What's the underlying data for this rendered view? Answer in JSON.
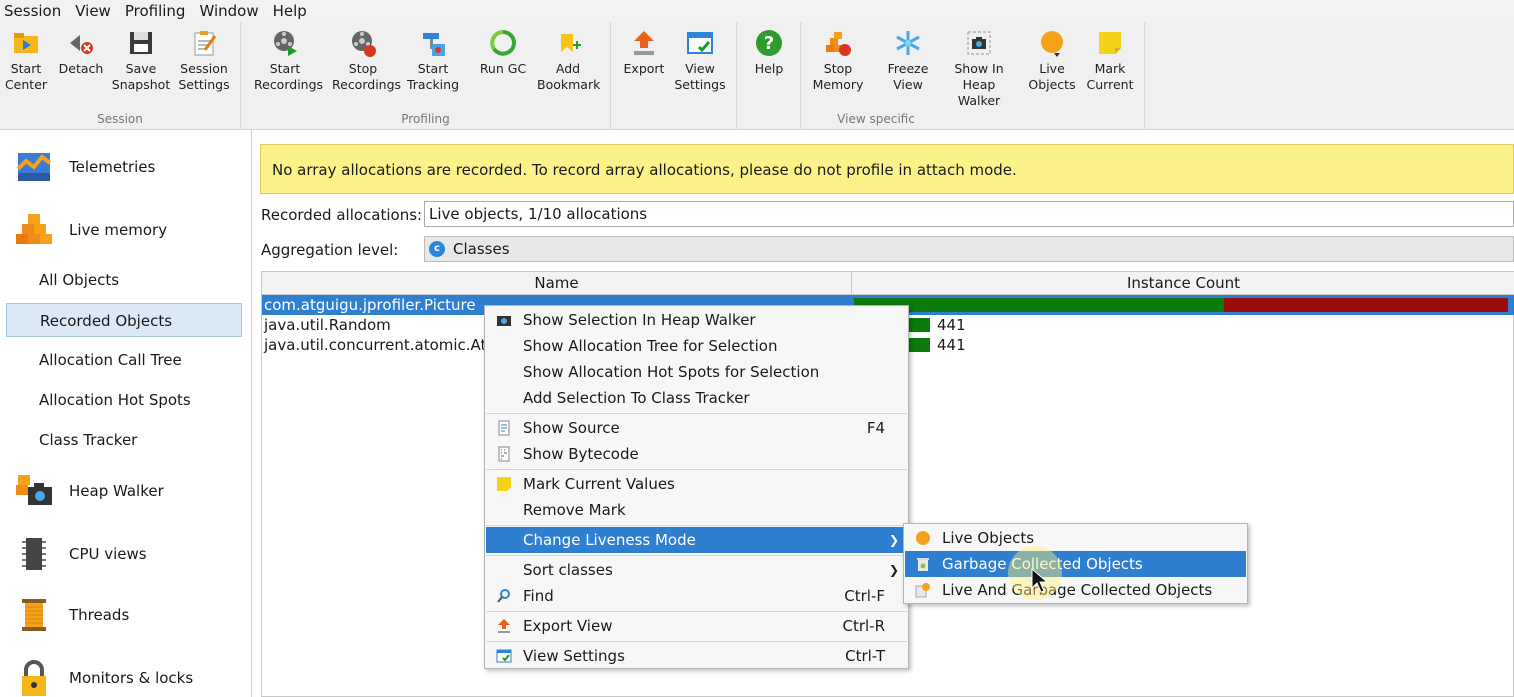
{
  "menubar": [
    "Session",
    "View",
    "Profiling",
    "Window",
    "Help"
  ],
  "toolbar": {
    "groups": {
      "session": "Session",
      "profiling": "Profiling",
      "view_specific": "View specific"
    },
    "buttons": {
      "start_center": "Start\nCenter",
      "detach": "Detach",
      "save_snapshot": "Save\nSnapshot",
      "session_settings": "Session\nSettings",
      "start_recordings": "Start\nRecordings",
      "stop_recordings": "Stop\nRecordings",
      "start_tracking": "Start\nTracking",
      "run_gc": "Run GC",
      "add_bookmark": "Add\nBookmark",
      "export": "Export",
      "view_settings": "View\nSettings",
      "help": "Help",
      "stop_memory": "Stop\nMemory",
      "freeze_view": "Freeze\nView",
      "show_in_heap_walker": "Show In\nHeap Walker",
      "live_objects": "Live\nObjects",
      "mark_current": "Mark\nCurrent"
    }
  },
  "sidebar": {
    "telemetries": "Telemetries",
    "live_memory": "Live memory",
    "sub": [
      "All Objects",
      "Recorded Objects",
      "Allocation Call Tree",
      "Allocation Hot Spots",
      "Class Tracker"
    ],
    "heap_walker": "Heap Walker",
    "cpu_views": "CPU views",
    "threads": "Threads",
    "monitors_locks": "Monitors & locks"
  },
  "banner": "No array allocations are recorded. To record array allocations, please do not profile in attach mode.",
  "recorded": {
    "label": "Recorded allocations:",
    "value": "Live objects, 1/10 allocations"
  },
  "aggregation": {
    "label": "Aggregation level:",
    "value": "Classes"
  },
  "table": {
    "headers": [
      "Name",
      "Instance Count"
    ],
    "rows": [
      {
        "name": "com.atguigu.jprofiler.Picture",
        "count": ""
      },
      {
        "name": "java.util.Random",
        "count": "441"
      },
      {
        "name": "java.util.concurrent.atomic.Ato",
        "count": "441"
      }
    ]
  },
  "context_menu": {
    "show_selection_heap_walker": "Show Selection In Heap Walker",
    "show_alloc_tree": "Show Allocation Tree for Selection",
    "show_alloc_hot": "Show Allocation Hot Spots for Selection",
    "add_class_tracker": "Add Selection To Class Tracker",
    "show_source": "Show Source",
    "show_source_sc": "F4",
    "show_bytecode": "Show Bytecode",
    "mark_current": "Mark Current Values",
    "remove_mark": "Remove Mark",
    "change_liveness": "Change Liveness Mode",
    "sort_classes": "Sort classes",
    "find": "Find",
    "find_sc": "Ctrl-F",
    "export_view": "Export View",
    "export_view_sc": "Ctrl-R",
    "view_settings": "View Settings",
    "view_settings_sc": "Ctrl-T"
  },
  "submenu": {
    "live_objects": "Live Objects",
    "gc_objects": "Garbage Collected Objects",
    "live_and_gc": "Live And Garbage Collected Objects"
  },
  "colors": {
    "selection": "#2f7fd1",
    "bar_green": "#0a7a0a",
    "bar_red": "#9a0c0c",
    "banner": "#fbf28a"
  }
}
